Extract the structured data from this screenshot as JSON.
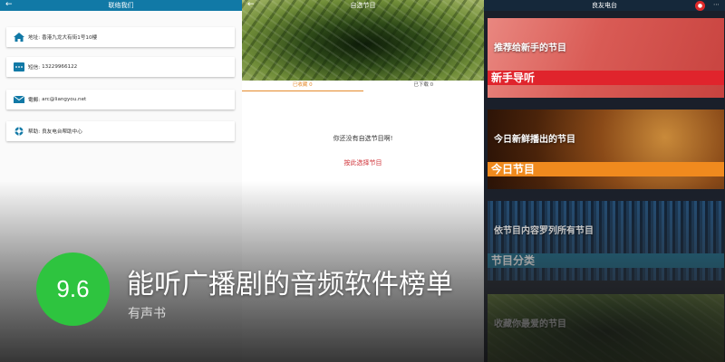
{
  "contact": {
    "back_icon": "back-arrow-icon",
    "title": "联络我们",
    "items": [
      {
        "icon": "home-icon",
        "label": "地址:",
        "value": "香港九龙大有街1号10樓"
      },
      {
        "icon": "phone-icon",
        "label": "短信:",
        "value": "13229966122"
      },
      {
        "icon": "mail-icon",
        "label": "電郵:",
        "value": "arc@liangyou.net"
      },
      {
        "icon": "lifebuoy-icon",
        "label": "帮助:",
        "value": "良友电台帮助中心"
      }
    ]
  },
  "favorites": {
    "back_icon": "back-arrow-icon",
    "title": "自选节目",
    "tabs": [
      {
        "label": "已收藏",
        "count": "0",
        "active": true
      },
      {
        "label": "已下载",
        "count": "0",
        "active": false
      }
    ],
    "empty_message": "你还没有自选节目啊!",
    "pick_link": "按此选择节目"
  },
  "radio": {
    "title": "良友电台",
    "bell_icon": "bell-icon",
    "more_icon": "more-icon",
    "tiles": [
      {
        "desc": "推荐给新手的节目",
        "tag": "新手导听"
      },
      {
        "desc": "今日新鲜播出的节目",
        "tag": "今日节目"
      },
      {
        "desc": "依节目内容罗列所有节目",
        "tag": "节目分类"
      },
      {
        "desc": "收藏你最爱的节目",
        "tag": ""
      }
    ]
  },
  "overlay": {
    "score": "9.6",
    "headline": "能听广播剧的音频软件榜单",
    "subline": "有声书"
  },
  "colors": {
    "contact_bar": "#1179a6",
    "tab_active": "#e58a2c",
    "link_red": "#d0343a",
    "tag_red": "#e0242c",
    "tag_orange": "#f08a1e",
    "tag_teal": "#1d6f8f",
    "score_green": "#2ec43f"
  }
}
